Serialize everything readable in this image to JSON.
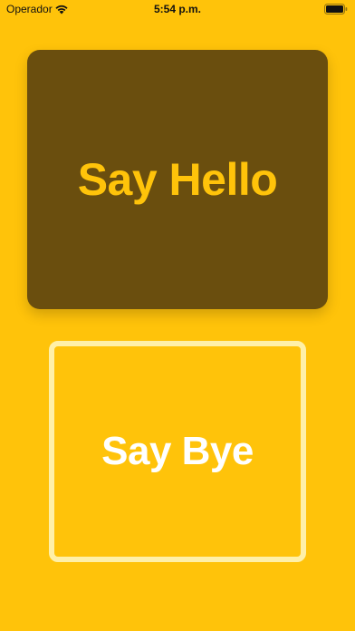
{
  "status_bar": {
    "carrier": "Operador",
    "time": "5:54 p.m.",
    "icons": [
      "wifi-icon",
      "battery-icon"
    ]
  },
  "buttons": {
    "hello_label": "Say Hello",
    "bye_label": "Say Bye"
  },
  "colors": {
    "background": "#FFC30A",
    "hello_button_bg": "#6A4E0E",
    "hello_text": "#FFC30A",
    "bye_border": "#FFF0A8",
    "bye_text": "#FFFFFF"
  }
}
